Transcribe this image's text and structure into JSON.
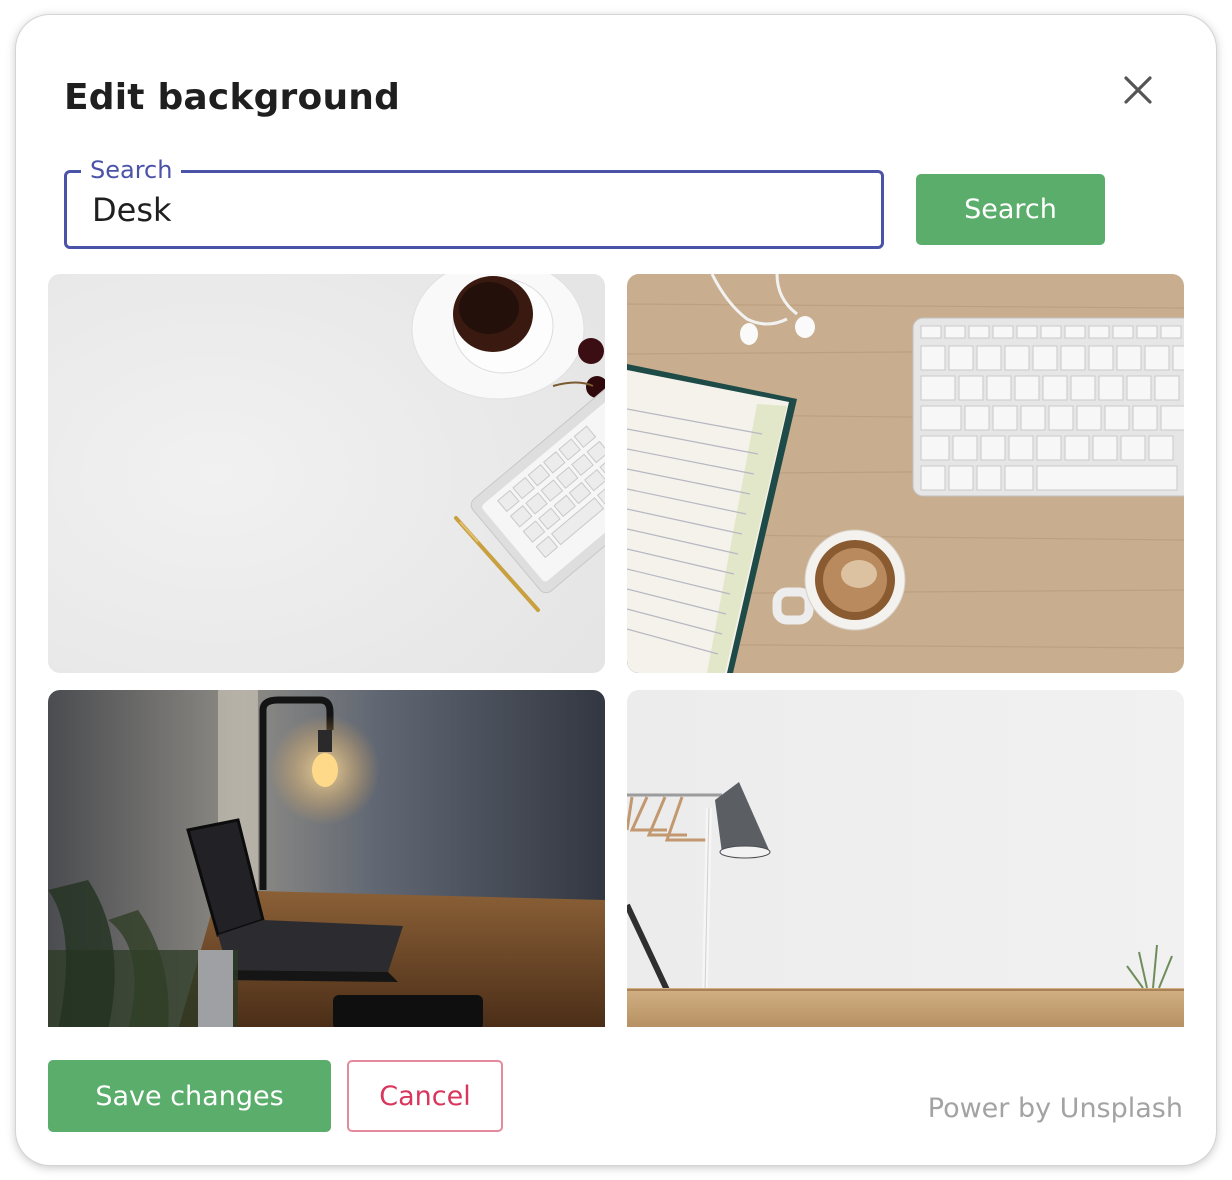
{
  "dialog": {
    "title": "Edit background",
    "close_icon": "close-icon"
  },
  "search": {
    "legend": "Search",
    "value": "Desk",
    "button_label": "Search"
  },
  "results": [
    {
      "name": "desk-photo-white-keyboard-coffee",
      "selected": false
    },
    {
      "name": "desk-photo-wood-keyboard-notebook",
      "selected": false
    },
    {
      "name": "desk-photo-laptop-lamp",
      "selected": false
    },
    {
      "name": "desk-photo-lamp-wall",
      "selected": false
    }
  ],
  "footer": {
    "save_label": "Save changes",
    "cancel_label": "Cancel",
    "credit": "Power by Unsplash"
  },
  "colors": {
    "primary": "#5aad6a",
    "focus": "#4a53a8",
    "danger": "#d9365d"
  }
}
